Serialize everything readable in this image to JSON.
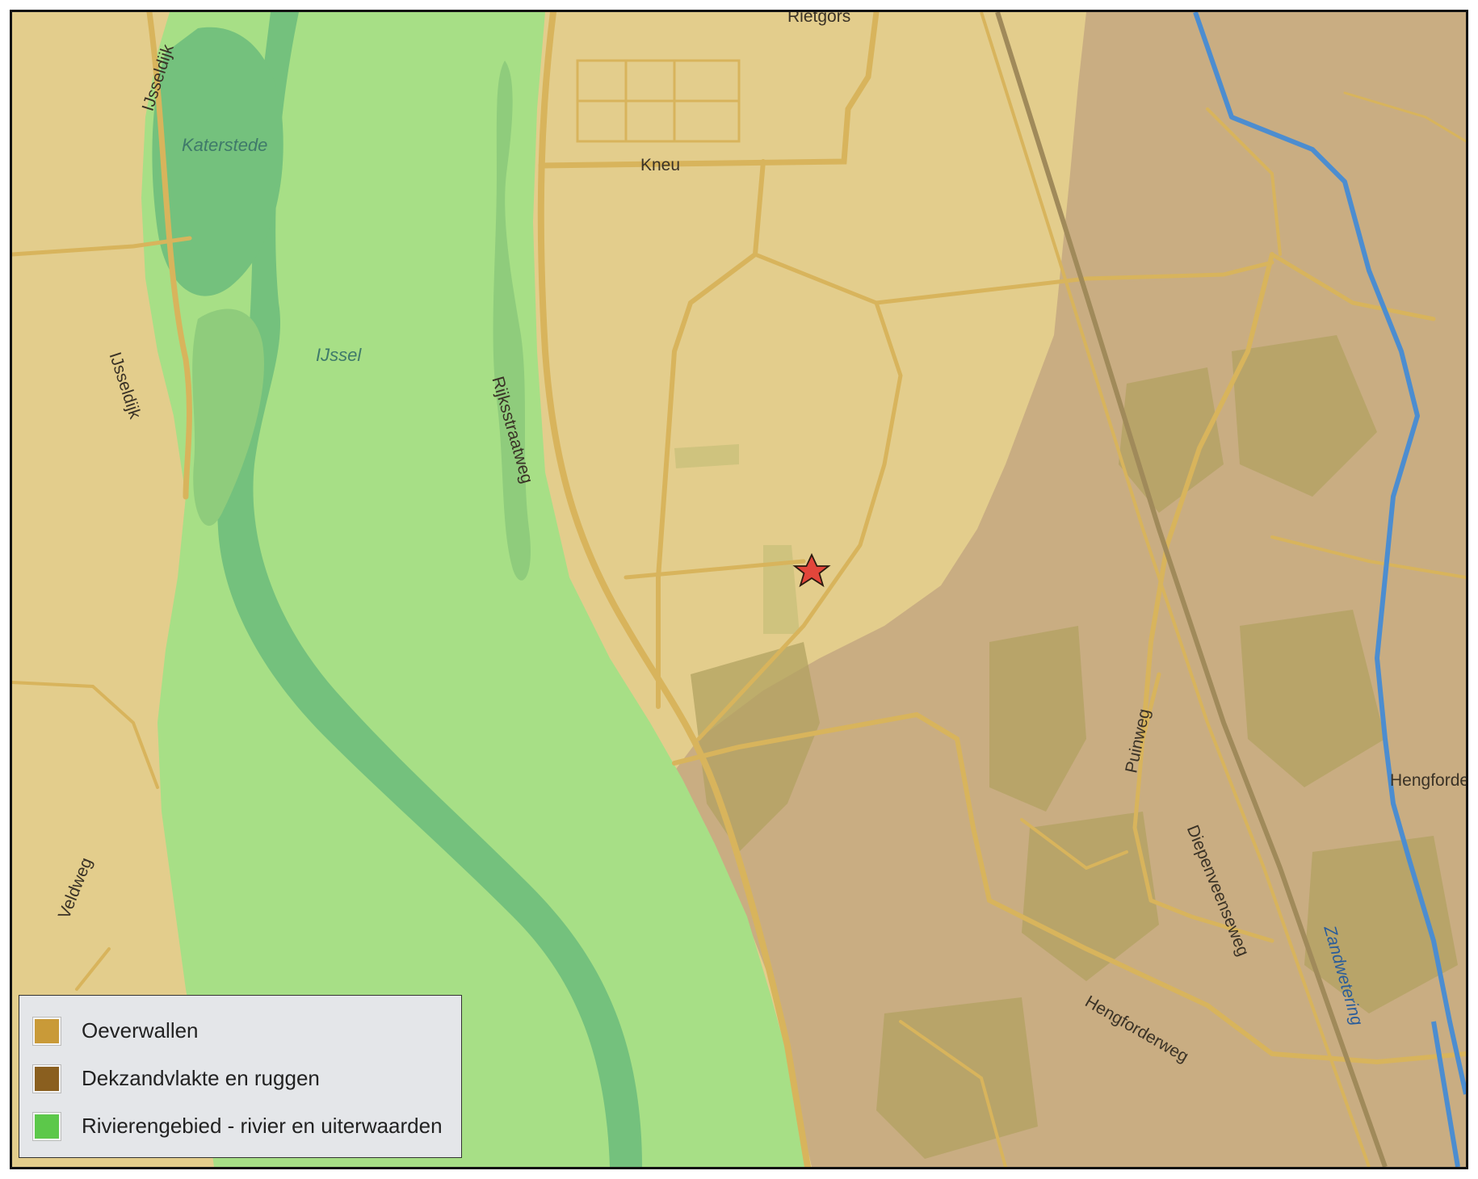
{
  "map": {
    "colors": {
      "oeverwallen_area": "#e3cd8c",
      "dekzand_area": "#c9ad82",
      "river_area": "#a7df86",
      "river_water": "#74c17d",
      "forest": "#b2a260",
      "road": "#d8b45c",
      "stream": "#4c8dd0",
      "marker": "#e2463b"
    },
    "marker_icon": "red-star-marker",
    "labels": {
      "rietgors": "Rietgors",
      "kneu": "Kneu",
      "ijsseldijk_top": "IJsseldijk",
      "ijsseldijk_mid": "IJsseldijk",
      "katerstede": "Katerstede",
      "ijssel": "IJssel",
      "rijksstraatweg": "Rijksstraatweg",
      "veldweg": "Veldweg",
      "puinweg": "Puinweg",
      "diepenveenseweg": "Diepenveenseweg",
      "hengforderweg": "Hengforderweg",
      "hengforden": "Hengforde",
      "zandwetering": "Zandwetering"
    }
  },
  "legend": {
    "items": [
      {
        "label": "Oeverwallen",
        "color": "#c99a38"
      },
      {
        "label": "Dekzandvlakte en ruggen",
        "color": "#8a5f1f"
      },
      {
        "label": "Rivierengebied - rivier en uiterwaarden",
        "color": "#5cc84a"
      }
    ]
  }
}
